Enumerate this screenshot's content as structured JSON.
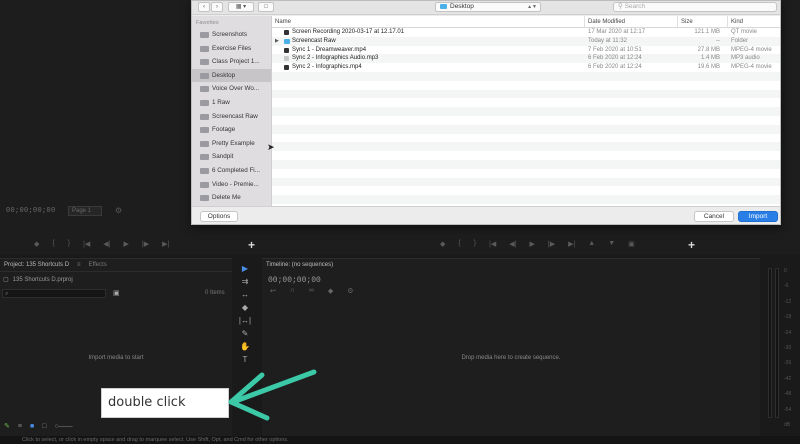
{
  "background": {
    "source_timecode": "00;00;00;00",
    "fit_label": "Page 1",
    "project_panel": {
      "tab_project": "Project: 135 Shortcuts D",
      "tab_effects": "Effects",
      "project_file": "135 Shortcuts D.prproj",
      "search_placeholder": "⌕",
      "items_count": "0 Items",
      "empty_message": "Import media to start"
    },
    "timeline": {
      "tab_label": "Timeline: (no sequences)",
      "timecode": "00;00;00;00",
      "drop_message": "Drop media here to create sequence."
    },
    "meter_scale": [
      "0",
      "-6",
      "-12",
      "-18",
      "-24",
      "-30",
      "-36",
      "-42",
      "-48",
      "-54",
      "dB"
    ],
    "status_text": "Click to select, or click in empty space and drag to marquee select. Use Shift, Opt, and Cmd for other options."
  },
  "dialog": {
    "location": "Desktop",
    "search_placeholder": "Search",
    "sidebar_header": "Favorites",
    "sidebar_items": [
      "Screenshots",
      "Exercise Files",
      "Class Project 1...",
      "Desktop",
      "Voice Over Wo...",
      "1 Raw",
      "Screencast Raw",
      "Footage",
      "Pretty Example",
      "Sandpit",
      "6 Completed Fi...",
      "Video - Premie...",
      "Delete Me"
    ],
    "selected_sidebar_index": 3,
    "columns": {
      "name": "Name",
      "date": "Date Modified",
      "size": "Size",
      "kind": "Kind"
    },
    "files": [
      {
        "name": "Screen Recording 2020-03-17 at 12.17.01",
        "date": "17 Mar 2020 at 12:17",
        "size": "121.1 MB",
        "kind": "QT movie",
        "icon": "movie-icon"
      },
      {
        "name": "Screencast Raw",
        "date": "Today at 11:32",
        "size": "--",
        "kind": "Folder",
        "icon": "folder-icon"
      },
      {
        "name": "Sync 1 - Dreamweaver.mp4",
        "date": "7 Feb 2020 at 10:51",
        "size": "27.8 MB",
        "kind": "MPEG-4 movie",
        "icon": "movie-icon"
      },
      {
        "name": "Sync 2 - Infographics Audio.mp3",
        "date": "6 Feb 2020 at 12:24",
        "size": "1.4 MB",
        "kind": "MP3 audio",
        "icon": "audio-icon"
      },
      {
        "name": "Sync 2 - Infographics.mp4",
        "date": "6 Feb 2020 at 12:24",
        "size": "19.6 MB",
        "kind": "MPEG-4 movie",
        "icon": "movie-icon"
      }
    ],
    "buttons": {
      "options": "Options",
      "cancel": "Cancel",
      "import": "Import"
    },
    "accent_color": "#2a7fe6"
  },
  "annotation": {
    "label": "double click",
    "arrow_color": "#3cc9a7"
  }
}
